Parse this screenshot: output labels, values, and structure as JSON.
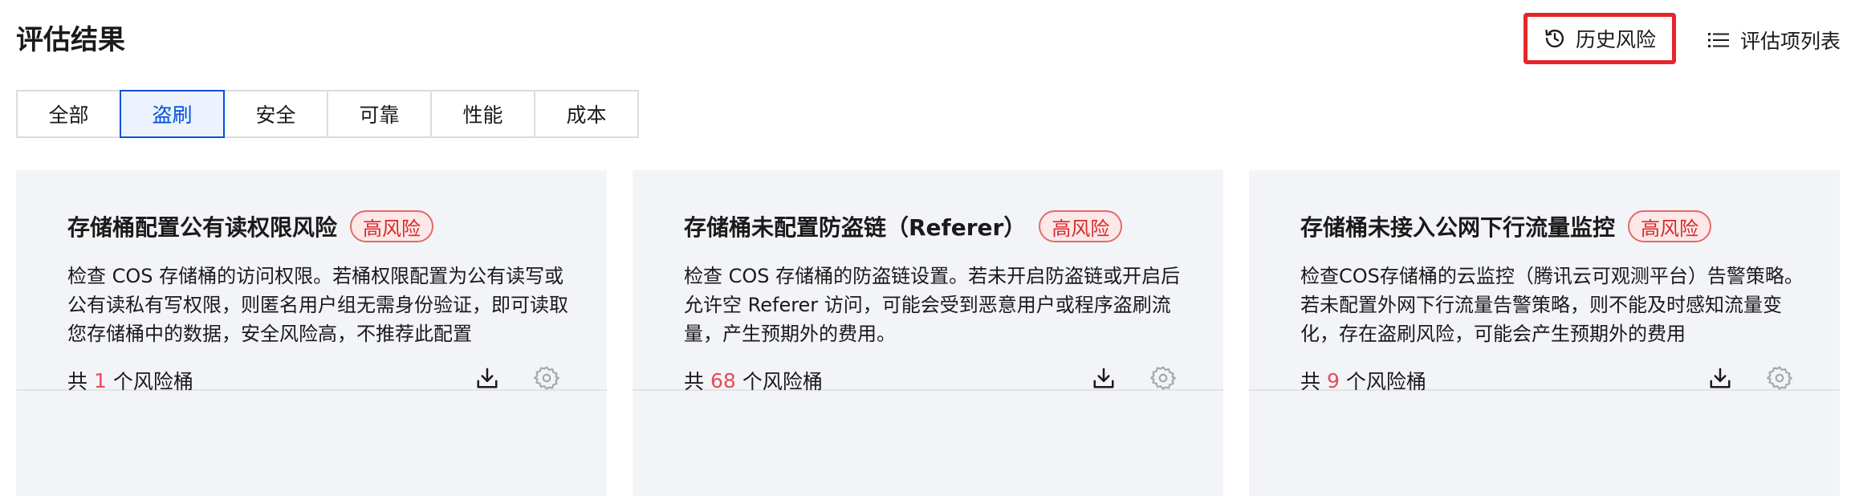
{
  "header": {
    "title": "评估结果",
    "history_label": "历史风险",
    "list_label": "评估项列表"
  },
  "tabs": [
    {
      "label": "全部",
      "active": false
    },
    {
      "label": "盗刷",
      "active": true
    },
    {
      "label": "安全",
      "active": false
    },
    {
      "label": "可靠",
      "active": false
    },
    {
      "label": "性能",
      "active": false
    },
    {
      "label": "成本",
      "active": false
    }
  ],
  "cards": [
    {
      "title": "存储桶配置公有读权限风险",
      "badge": "高风险",
      "description": "检查 COS 存储桶的访问权限。若桶权限配置为公有读写或公有读私有写权限，则匿名用户组无需身份验证，即可读取您存储桶中的数据，安全风险高，不推荐此配置",
      "count_prefix": "共",
      "count": "1",
      "count_suffix": "个风险桶"
    },
    {
      "title": "存储桶未配置防盗链（Referer）",
      "badge": "高风险",
      "description": "检查 COS 存储桶的防盗链设置。若未开启防盗链或开启后允许空 Referer 访问，可能会受到恶意用户或程序盗刷流量，产生预期外的费用。",
      "count_prefix": "共",
      "count": "68",
      "count_suffix": "个风险桶"
    },
    {
      "title": "存储桶未接入公网下行流量监控",
      "badge": "高风险",
      "description": "检查COS存储桶的云监控（腾讯云可观测平台）告警策略。若未配置外网下行流量告警策略，则不能及时感知流量变化，存在盗刷风险，可能会产生预期外的费用",
      "count_prefix": "共",
      "count": "9",
      "count_suffix": "个风险桶"
    }
  ],
  "colors": {
    "accent": "#0052d9",
    "danger": "#e34d59",
    "highlight_border": "#e5262b",
    "card_bg": "#f3f4f7"
  },
  "icons": {
    "history": "history-icon",
    "list": "list-icon",
    "download": "download-icon",
    "settings": "gear-icon"
  }
}
